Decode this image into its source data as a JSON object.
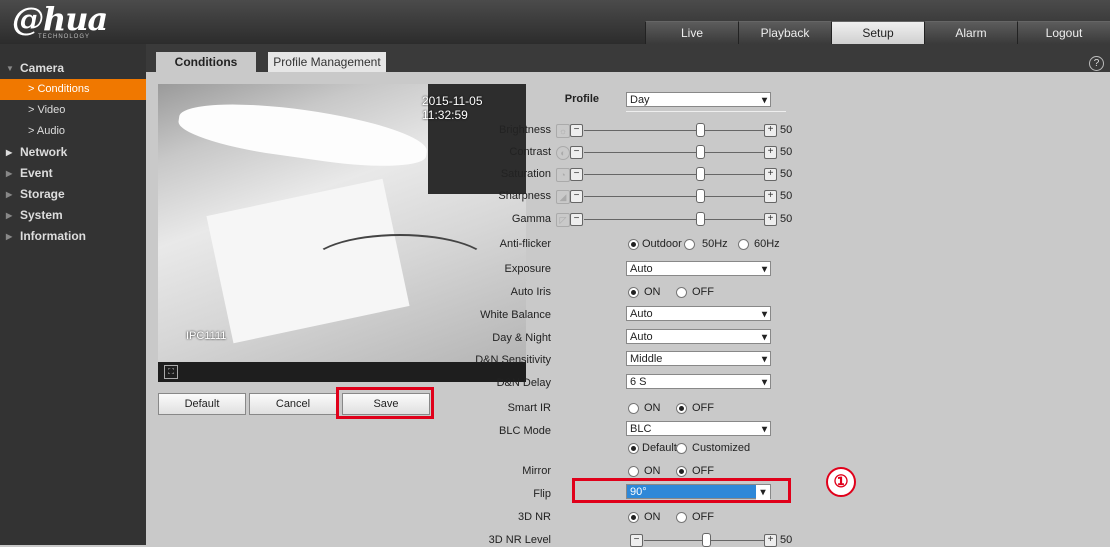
{
  "brand": {
    "logo": "@hua",
    "tagline": "TECHNOLOGY"
  },
  "topnav": [
    {
      "label": "Live"
    },
    {
      "label": "Playback"
    },
    {
      "label": "Setup"
    },
    {
      "label": "Alarm"
    },
    {
      "label": "Logout"
    }
  ],
  "sidebar": {
    "camera": "Camera",
    "conditions": "> Conditions",
    "video": "> Video",
    "audio": "> Audio",
    "network": "Network",
    "event": "Event",
    "storage": "Storage",
    "system": "System",
    "information": "Information"
  },
  "subtabs": {
    "conditions": "Conditions",
    "profile_management": "Profile Management"
  },
  "help_icon_glyph": "?",
  "video": {
    "timestamp": "2015-11-05 11:32:59",
    "overlay_label": "IPC1111"
  },
  "buttons": {
    "default": "Default",
    "cancel": "Cancel",
    "save": "Save"
  },
  "settings": {
    "profile": {
      "label": "Profile",
      "value": "Day"
    },
    "brightness": {
      "label": "Brightness",
      "value": "50"
    },
    "contrast": {
      "label": "Contrast",
      "value": "50"
    },
    "saturation": {
      "label": "Saturation",
      "value": "50"
    },
    "sharpness": {
      "label": "Sharpness",
      "value": "50"
    },
    "gamma": {
      "label": "Gamma",
      "value": "50"
    },
    "anti_flicker": {
      "label": "Anti-flicker",
      "options": [
        "Outdoor",
        "50Hz",
        "60Hz"
      ],
      "selected": "Outdoor"
    },
    "exposure": {
      "label": "Exposure",
      "value": "Auto"
    },
    "auto_iris": {
      "label": "Auto Iris",
      "options": [
        "ON",
        "OFF"
      ],
      "selected": "ON"
    },
    "white_balance": {
      "label": "White Balance",
      "value": "Auto"
    },
    "day_night": {
      "label": "Day & Night",
      "value": "Auto"
    },
    "dn_sensitivity": {
      "label": "D&N Sensitivity",
      "value": "Middle"
    },
    "dn_delay": {
      "label": "D&N Delay",
      "value": "6 S"
    },
    "smart_ir": {
      "label": "Smart IR",
      "options": [
        "ON",
        "OFF"
      ],
      "selected": "OFF"
    },
    "blc_mode": {
      "label": "BLC Mode",
      "value": "BLC",
      "sub_options": [
        "Default",
        "Customized"
      ],
      "sub_selected": "Default"
    },
    "mirror": {
      "label": "Mirror",
      "options": [
        "ON",
        "OFF"
      ],
      "selected": "OFF"
    },
    "flip": {
      "label": "Flip",
      "value": "90°"
    },
    "nr3d": {
      "label": "3D NR",
      "options": [
        "ON",
        "OFF"
      ],
      "selected": "ON"
    },
    "nr3d_level": {
      "label": "3D NR Level",
      "value": "50"
    }
  },
  "annotation": {
    "marker": "①"
  },
  "colors": {
    "highlight": "#e0001a",
    "active_nav": "#f07800",
    "selected_option": "#2e88d8"
  }
}
